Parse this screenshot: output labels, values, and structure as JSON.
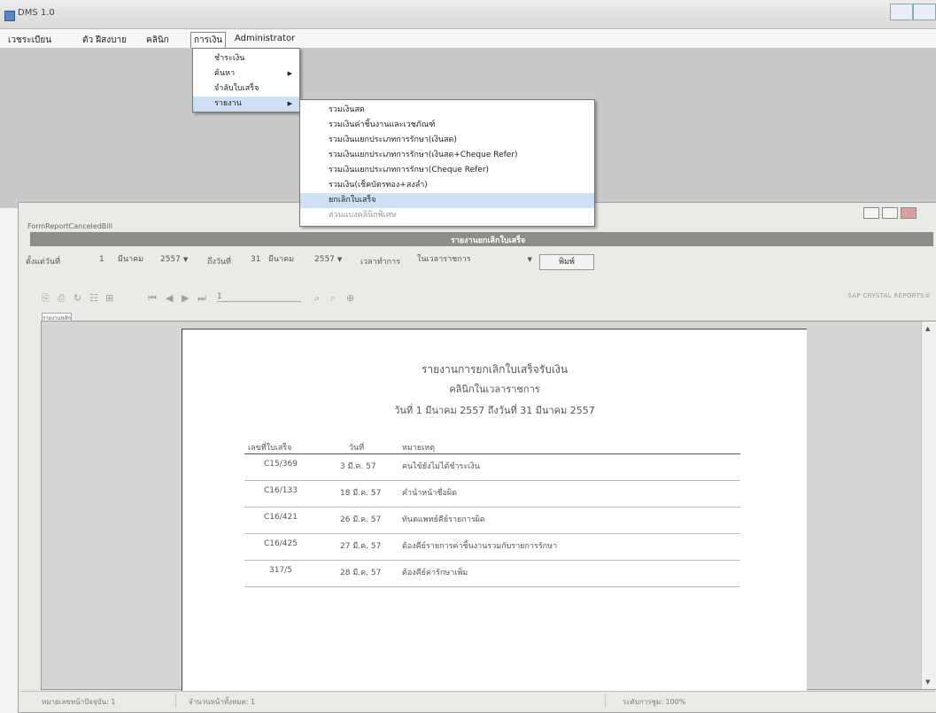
{
  "app": {
    "title": "DMS 1.0"
  },
  "menubar": {
    "items": [
      "เวชระเบียน",
      "ตัว ฝีสงบาย",
      "คลินิก",
      "การเงิน",
      "Administrator"
    ]
  },
  "finance_menu": {
    "items": [
      "ชำระเงิน",
      "ค้นหา",
      "จำลับใบเสร็จ",
      "รายงาน"
    ]
  },
  "report_submenu": {
    "items": [
      "รวมเงินสด",
      "รวมเงินค่าชิ้นงานและเวชภัณฑ์",
      "รวมเงินแยกประเภทการรักษา(เงินสด)",
      "รวมเงินแยกประเภทการรักษา(เงินสด+Cheque Refer)",
      "รวมเงินแยกประเภทการรักษา(Cheque Refer)",
      "รวมเงิน(เช็คบัตรทอง+สงลำ)",
      "ยกเลิกใบเสร็จ",
      "ส่วนแบ่งคลินิกพิเศษ"
    ]
  },
  "child": {
    "title": "FormReportCanceledBill",
    "banner": "รายงานยกเลิกใบเสร็จ"
  },
  "filters": {
    "from_label": "ตั้งแต่วันที่",
    "from_day": "1",
    "from_month": "มีนาคม",
    "from_year": "2557",
    "to_label": "ถึงวันที่",
    "to_day": "31",
    "to_month": "มีนาคม",
    "to_year": "2557",
    "time_label": "เวลาทำการ",
    "time_value": "ในเวลาราชการ",
    "print_button": "พิมพ์"
  },
  "toolbar": {
    "page_num": "1",
    "brand": "SAP CRYSTAL REPORTS®",
    "tab_label": "รายงานหลัก"
  },
  "report": {
    "title": "รายงานการยกเลิกใบเสร็จรับเงิน",
    "subtitle": "คลินิกในเวลาราชการ",
    "date_range": "วันที่  1 มีนาคม 2557 ถึงวันที่ 31 มีนาคม 2557",
    "columns": [
      "เลขที่ใบเสร็จ",
      "วันที่",
      "หมายเหตุ"
    ],
    "rows": [
      {
        "no": "C15/369",
        "date": "3 มี.ค. 57",
        "note": "คนไข้ยังไม่ได้ชำระเงิน"
      },
      {
        "no": "C16/133",
        "date": "18 มี.ค. 57",
        "note": "คำนำหน้าชื่อผิด"
      },
      {
        "no": "C16/421",
        "date": "26 มี.ค. 57",
        "note": "ทันตแพทย์คีย์รายการผิด"
      },
      {
        "no": "C16/425",
        "date": "27 มี.ค. 57",
        "note": "ต้องคีย์รายการค่าชิ้นงานรวมกับรายการรักษา"
      },
      {
        "no": "317/5",
        "date": "28 มี.ค. 57",
        "note": "ต้องคีย์ค่ารักษาเพิ่ม"
      }
    ]
  },
  "status": {
    "page": "หมายเลขหน้าปัจจุบัน: 1",
    "total": "จำนวนหน้าทั้งหมด: 1",
    "zoom": "ระดับการซูม: 100%"
  }
}
